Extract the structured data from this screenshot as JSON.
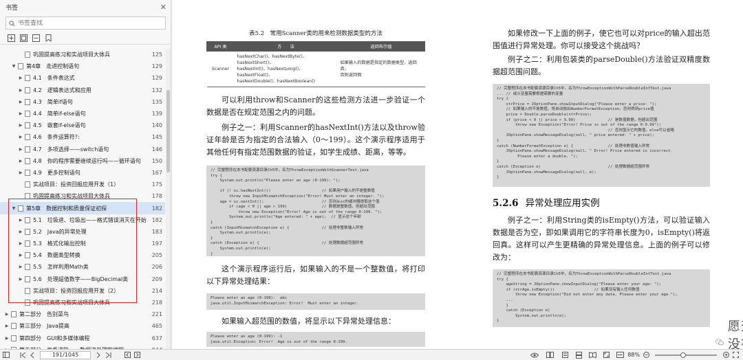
{
  "sidebar": {
    "title": "书签",
    "close": "✕",
    "search_placeholder": "书签查找",
    "toc": [
      {
        "label": "巩固提高练习和实战项目大体兵",
        "page": "125",
        "level": 2,
        "arrow": ""
      },
      {
        "label": "第4章　走进控制语句",
        "page": "129",
        "level": 1,
        "arrow": "▼"
      },
      {
        "label": "4.1　条件表达式",
        "page": "129",
        "level": 2,
        "arrow": "▶"
      },
      {
        "label": "4.2　逻辑表达式和应用",
        "page": "132",
        "level": 2,
        "arrow": "▶"
      },
      {
        "label": "4.3　简单if语句",
        "page": "135",
        "level": 2,
        "arrow": "▶"
      },
      {
        "label": "4.4　简单if-else语句",
        "page": "139",
        "level": 2,
        "arrow": "▶"
      },
      {
        "label": "4.5　嵌套if-else语句",
        "page": "140",
        "level": 2,
        "arrow": "▶"
      },
      {
        "label": "4.6　条件运算符?:",
        "page": "145",
        "level": 2,
        "arrow": "▶"
      },
      {
        "label": "4.7　多项选择——switch语句",
        "page": "146",
        "level": 2,
        "arrow": "▶"
      },
      {
        "label": "4.8　你的程序需要继续运行吗——循环语句",
        "page": "150",
        "level": 2,
        "arrow": "▶"
      },
      {
        "label": "4.9　更多控制语句",
        "page": "167",
        "level": 2,
        "arrow": "▶"
      },
      {
        "label": "实战项目：投资回报应用开发（1）",
        "page": "175",
        "level": 2,
        "arrow": ""
      },
      {
        "label": "巩固提高练习和实战项目大体兵",
        "page": "178",
        "level": 2,
        "arrow": ""
      },
      {
        "label": "第5章　数据控制和质量保证初探",
        "page": "182",
        "level": 1,
        "arrow": "▼"
      },
      {
        "label": "5.1　垃圾进、垃圾出——格式错误消灭在开始",
        "page": "182",
        "level": 2,
        "arrow": "▶"
      },
      {
        "label": "5.2　Java的异常处理",
        "page": "183",
        "level": 2,
        "arrow": "▶"
      },
      {
        "label": "5.3　格式化输出控制",
        "page": "197",
        "level": 2,
        "arrow": "▶"
      },
      {
        "label": "5.4　数据类型转换",
        "page": "205",
        "level": 2,
        "arrow": "▶"
      },
      {
        "label": "5.5　怎样利用Math类",
        "page": "206",
        "level": 2,
        "arrow": "▶"
      },
      {
        "label": "5.6　处理超值数字——BigDecimal类",
        "page": "209",
        "level": 2,
        "arrow": "▶"
      },
      {
        "label": "实战项目：投资回报应用开发（2）",
        "page": "214",
        "level": 2,
        "arrow": ""
      },
      {
        "label": "巩固提高练习和实战项目大体兵",
        "page": "218",
        "level": 2,
        "arrow": ""
      },
      {
        "label": "第二部分　告别菜鸟",
        "page": "221",
        "level": 0,
        "arrow": "▶"
      },
      {
        "label": "第三部分　Java提高",
        "page": "465",
        "level": 0,
        "arrow": "▶"
      },
      {
        "label": "第四部分　GUI和多媒体编程",
        "page": "637",
        "level": 0,
        "arrow": "▶"
      },
      {
        "label": "第五部分　高手进阶——数据流处理和编程",
        "page": "844",
        "level": 0,
        "arrow": "▶"
      }
    ]
  },
  "doc": {
    "table_title": "表5.2　常用Scanner类的用来检测数据类型的方法",
    "table_headers": [
      "API 类",
      "方　　法",
      "返回布尔值"
    ],
    "table_row": {
      "api": "Scanner",
      "methods": [
        "hasNextChar()、hasNextByte()、hasNextShort()、",
        "hasNextInt()、hasNextLong()、hasNextFloat()、",
        "hasNextDouble()、hasNextBoolean()"
      ],
      "desc": [
        "如果输入的数据是指定的数据类型，返回真，",
        "否则返回假"
      ]
    },
    "left_para1": "可以利用throw和Scanner的这些检测方法进一步验证一个数据是否在规定范围之内的问题。",
    "left_para2": "例子之一：利用Scanner的hasNextInt()方法以及throw验证年龄是否为指定的合法输入（0～199）。这个演示程序适用于其他任何有指定范围数据的验证，如学生成绩、距离，等等。",
    "code1": "// 完整程序在本书配套资源目录Ch5中，名为ThrowExceptionWithScannerTest.java\ntry {\n    System.out.println(\"Please enter an age (0-199): \");\n\n    if (! sc.hasNextInt())                      // 如果用户输入的不是整数值\n        throw new InputMismatchException(\"Error! Must enter an integer. \");\n    age = sc.nextInt();                         // 否则从sc的缓冲器提取这个值\n        if (age < 0 || age > 199)               // 数据是整数值，但超出范围\n            throw new Exception(\"Error! Age is out of the range 0-199. \");\n        System.out.println(\"Age entered: \" + age);  // 显示这个年龄\n}\ncatch (InputMismatchException e) {              // 处理非整数输入异常\n    System.out.println(e);\n}\ncatch (Exception e) {                           // 处理数据超范围异常\n    System.out.println(e);\n}",
    "left_para3": "这个演示程序运行后，如果输入的不是一个整数值，将打印以下异常处理结果：",
    "output1": "Please enter an age (0-199):  abc\njava.util.InputMismatchException: Error!  Must enter an integer.",
    "left_para4": "如果输入超范围的数值，将显示以下异常处理信息：",
    "output2": "Please enter an age (0-199): -1\njava.util.Exception: Error!  Age is out of the range 0-199.",
    "right_para1": "如果修改一下上面的例子，使它也可以对price的输入超出范围值进行异常处理。你可以接受这个挑战吗？",
    "right_para2": "例子之二：利用包装类的parseDouble()方法验证双精度数据超范围问题。",
    "code2": "// 完整程序在本书配套资源目录Ch5中，名为ThrowExceptionWithParseDoubleIntTest.java\n... // 或义变量需要根据需要的变量\ntry {\n    strPrice = JOptionPane.showInputDialog(\"Please enter a price: \");\n    // 如果输入的不是数值，将自动抛出NumberFormatException，否则得到price值\n    price = Double.parseDouble(strPrice);\n    if (price < 0 || price > 9.99)              // 是数值数据，但超出范围\n        throw new Exception(\"Error! Price is out of the range 0-9.99\");\n                                                // 否则显示它的数值，else可以省略\n    JOptionPane.showMessageDialog(null, \" price entered: \" + price);\n}\ncatch (NumberFormatException e) {               // 处理非数值输入异常\n    JOptionPane.showMessageDialog(null, \" Error! Price entered is incorrect.\n         Please enter a double. \");\n}\ncatch (Exception e)                             // 处理数据超范围异常\n    JOptionPane.showMessageDialog(null, e);\n}",
    "section_num": "5.2.6",
    "section_title": "异常处理应用实例",
    "right_para3": "例子之一：利用String类的isEmpty()方法，可以验证输入数据是否为空，即如果调用它的字符串长度为0，isEmpty()将返回真。这样可以产生更精确的异常处理信息。上面的例子可以修改为：",
    "code3": "// 完整程序在本书配套资源目录Ch5中，名为ThrowExceptionWithParseDoubleIntTest.java\ntry {\n    ageString = JOptionPane.showInputDialog(\"Please enter your age: \");\n    if (strAge.isEmpty())                 // 如果没有输入任何数值\n        throw new Exception(\"Did not enter any data. Please enter your age.\");\n    ...\n    }\n    catch (Exception e)\n        System.out.println(e);\n}",
    "watermark": "愿天堂没有BUG"
  },
  "statusbar": {
    "page_value": "191/1045",
    "zoom": "88%",
    "zoom_level": 0.45
  }
}
